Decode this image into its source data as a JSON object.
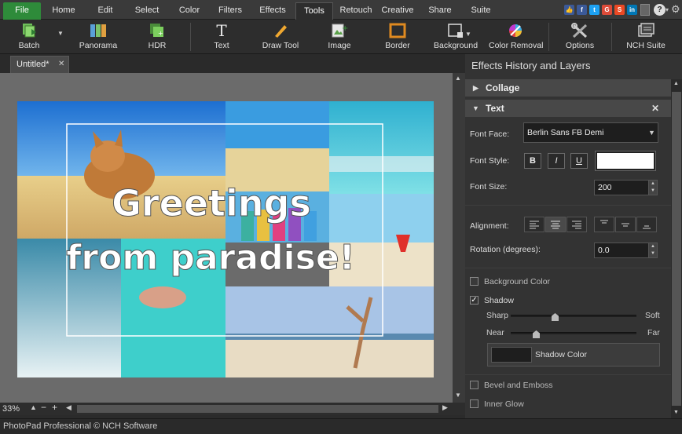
{
  "menu": {
    "tabs": [
      "File",
      "Home",
      "Edit",
      "Select",
      "Color",
      "Filters",
      "Effects",
      "Tools",
      "Retouch",
      "Creative",
      "Share",
      "Suite"
    ],
    "active": "Tools",
    "social": [
      "thumbs-up-icon",
      "facebook-icon",
      "twitter-icon",
      "google-plus-icon",
      "stumbleupon-icon",
      "linkedin-icon"
    ],
    "social_letters": [
      "👍",
      "f",
      "t",
      "G",
      "S",
      "in"
    ],
    "social_colors": [
      "#3b5998",
      "#3b5998",
      "#1da1f2",
      "#dd4b39",
      "#eb4924",
      "#0077b5"
    ]
  },
  "toolbar": {
    "tools": [
      "Batch",
      "Panorama",
      "HDR",
      "Text",
      "Draw Tool",
      "Image",
      "Border",
      "Background",
      "Color Removal",
      "Options",
      "NCH Suite"
    ],
    "text_glyph": "T"
  },
  "document": {
    "tab_title": "Untitled*",
    "close_glyph": "✕"
  },
  "canvas": {
    "greeting_line1": "Greetings",
    "greeting_line2": "from paradise!"
  },
  "view": {
    "zoom": "33%"
  },
  "status": {
    "text": "PhotoPad Professional © NCH Software"
  },
  "panel": {
    "title": "Effects History and Layers",
    "collage_header": "Collage",
    "text_header": "Text",
    "font_face_label": "Font Face:",
    "font_face_value": "Berlin Sans FB Demi",
    "font_style_label": "Font Style:",
    "bold": "B",
    "italic": "I",
    "underline": "U",
    "font_size_label": "Font Size:",
    "font_size_value": "200",
    "alignment_label": "Alignment:",
    "rotation_label": "Rotation (degrees):",
    "rotation_value": "0.0",
    "background_color_label": "Background Color",
    "shadow_label": "Shadow",
    "shadow_checked": true,
    "sharp_label": "Sharp",
    "soft_label": "Soft",
    "near_label": "Near",
    "far_label": "Far",
    "sharpness_level": 0.35,
    "distance_level": 0.2,
    "shadow_color_label": "Shadow Color",
    "bevel_label": "Bevel and Emboss",
    "inner_glow_label": "Inner Glow"
  },
  "colors": {
    "file_tab": "#2e8b3a",
    "panel_bg": "#333333",
    "canvas_bg": "#6b6b6b"
  }
}
